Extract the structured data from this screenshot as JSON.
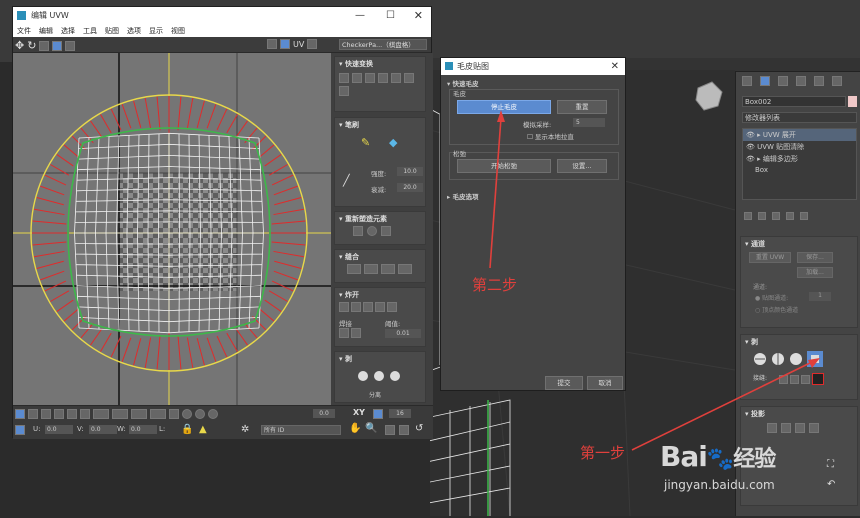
{
  "uvw_window": {
    "title": "编辑 UVW",
    "menu": [
      "文件",
      "编辑",
      "选择",
      "工具",
      "贴图",
      "选项",
      "显示",
      "视图"
    ],
    "uv_label": "UV",
    "checker_dropdown": "CheckerPa...（棋盘格）",
    "side_sections": {
      "quick_transform": "快速变换",
      "brush": "笔刷",
      "strength_label": "强度:",
      "strength_value": "10.0",
      "falloff_label": "衰减:",
      "falloff_value": "20.0",
      "reshape": "重新塑造元素",
      "stitch": "缝合",
      "explode": "炸开",
      "weld_label": "焊接",
      "threshold_label": "阈值:",
      "threshold_value": "0.01",
      "peel": "剥",
      "separate_label": "分离"
    },
    "bottom": {
      "u_label": "U:",
      "u_value": "0.0",
      "v_label": "V:",
      "v_value": "0.0",
      "w_label": "W:",
      "w_value": "0.0",
      "l_label": "L:",
      "rot_value": "0.0",
      "grid_value": "16",
      "xy_label": "XY",
      "id_dropdown": "所有 ID"
    }
  },
  "peel_dialog": {
    "title": "毛皮贴图",
    "section_quick": "快速毛皮",
    "group_pelt": "毛皮",
    "stop_pelt_button": "停止毛皮",
    "reset_button": "重置",
    "sample_label": "模拟采样:",
    "sample_value": "5",
    "show_local_label": "显示本地拉直",
    "group_stretch": "松弛",
    "start_relax_button": "开始松弛",
    "settings_button": "设置...",
    "section_options": "毛皮选项",
    "commit_button": "提交",
    "cancel_button": "取消"
  },
  "right_panel": {
    "object_name": "Box002",
    "modifier_list_label": "修改器列表",
    "stack": [
      "UVW 展开",
      "UVW 贴图清除",
      "编辑多边形",
      "Box"
    ],
    "channel_title": "通道",
    "reset_uvw": "重置 UVW",
    "save_btn": "保存...",
    "load_btn": "加载...",
    "channel_label": "通道:",
    "map_channel_label": "贴图通道:",
    "channel_value": "1",
    "vertex_color_label": "顶点颜色通道",
    "peel_title": "剥",
    "seam_label": "接缝:",
    "projection_title": "投影"
  },
  "annotations": {
    "step1": "第一步",
    "step2": "第二步"
  },
  "watermark": {
    "brand": "Bai",
    "brand_cn": "经验",
    "url": "jingyan.baidu.com"
  },
  "colors": {
    "accent_blue": "#5b8bd0",
    "annot_red": "#e0403c",
    "uv_yellow": "#e8d84a",
    "seam_green": "#3db84a",
    "stretch_red": "#e02b2b"
  }
}
